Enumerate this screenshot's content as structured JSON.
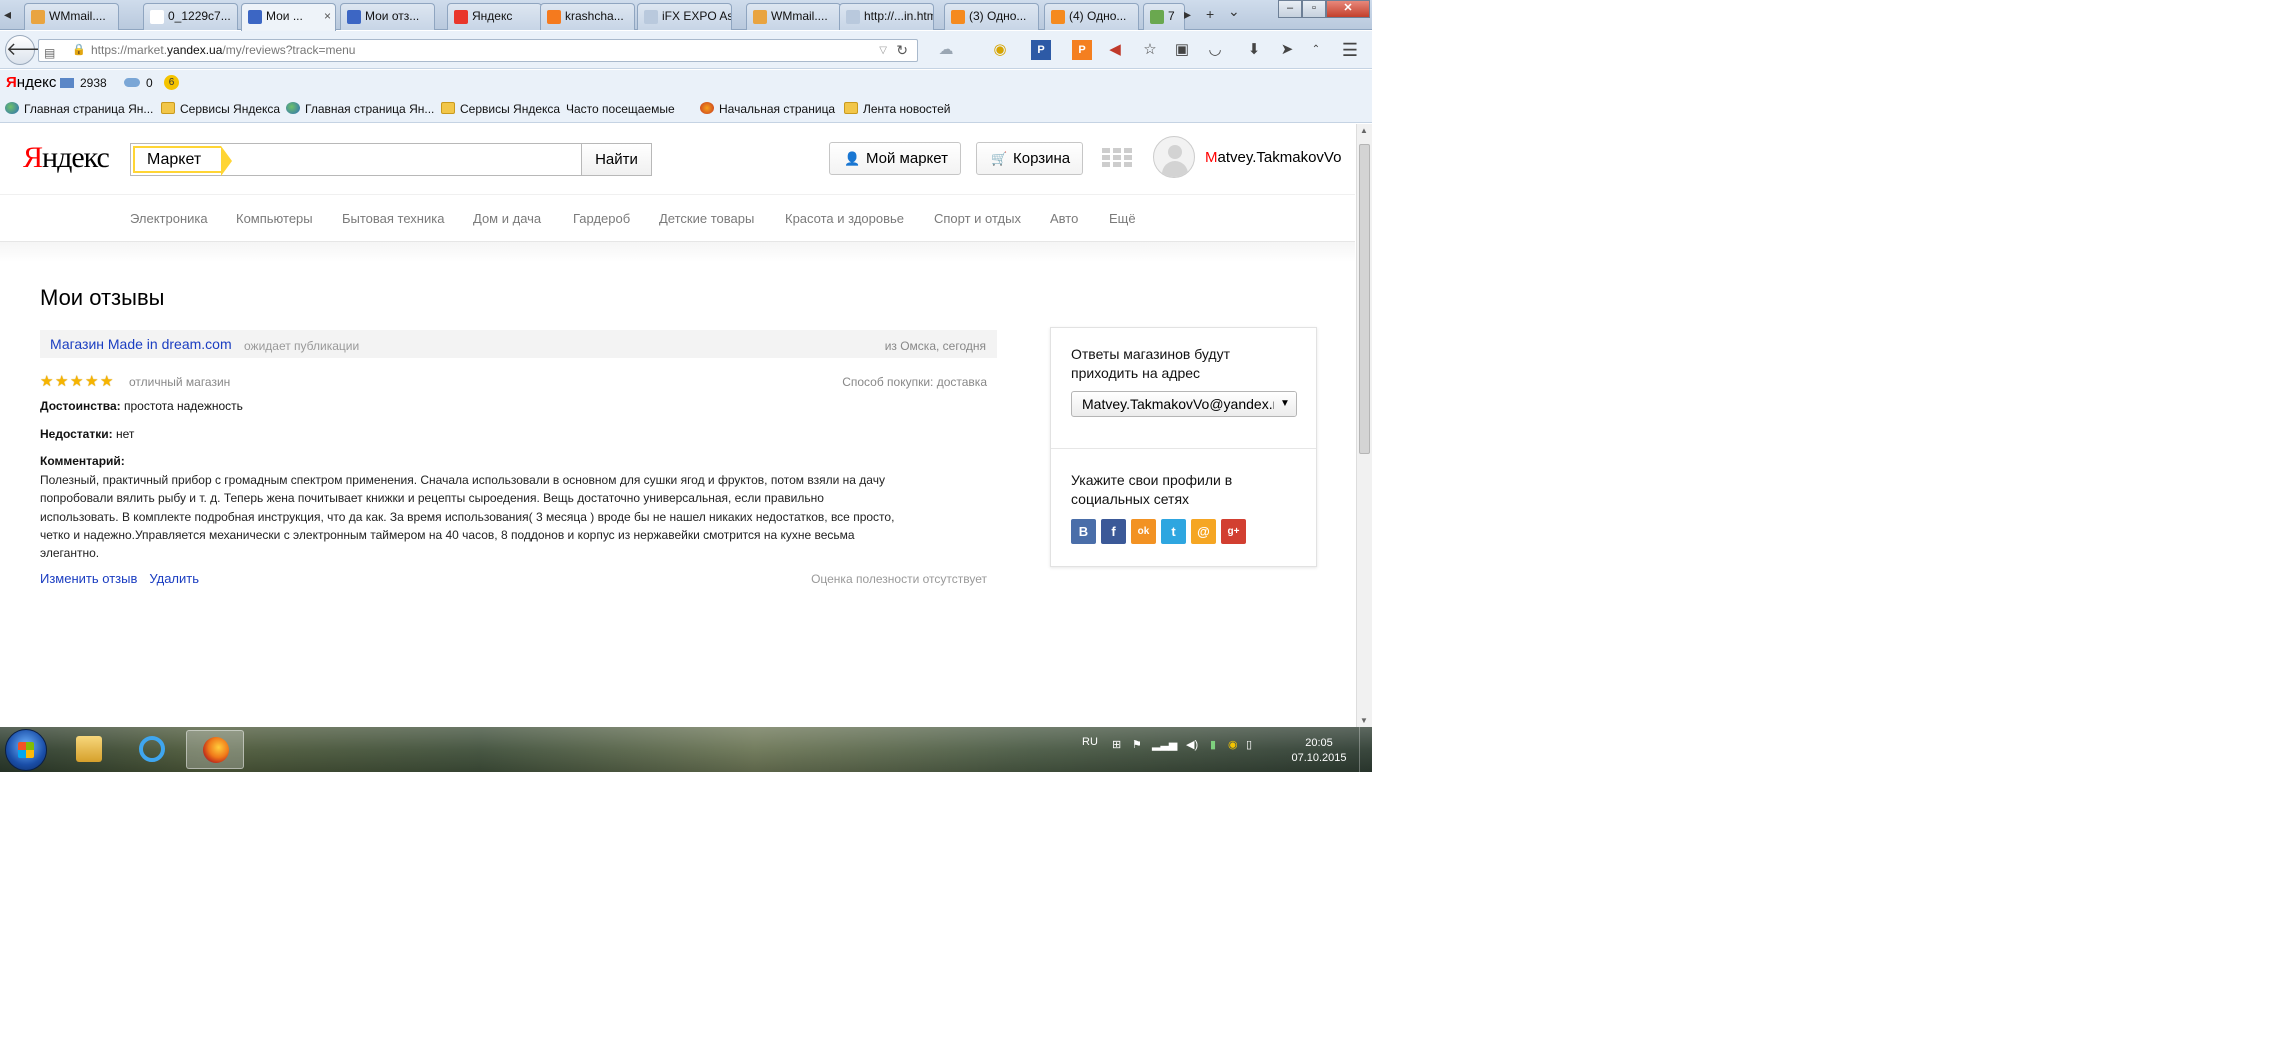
{
  "browser": {
    "tabs": [
      {
        "label": "WMmail....",
        "icon_color": "#e9a440"
      },
      {
        "label": "0_1229c7...",
        "icon_color": "#ffffff"
      },
      {
        "label": "Мои ...",
        "icon_color": "#3c66c4",
        "active": true
      },
      {
        "label": "Мои отз...",
        "icon_color": "#3c66c4"
      },
      {
        "label": "Яндекс",
        "icon_color": "#e9362b"
      },
      {
        "label": "krashcha...",
        "icon_color": "#f57a1e"
      },
      {
        "label": "iFX EXPO Asia...",
        "icon_color": "#b9c9dd"
      },
      {
        "label": "WMmail....",
        "icon_color": "#e9a440"
      },
      {
        "label": "http://...in.html",
        "icon_color": "#b9c9dd"
      },
      {
        "label": "(3) Одно...",
        "icon_color": "#f58a1e"
      },
      {
        "label": "(4) Одно...",
        "icon_color": "#f58a1e"
      },
      {
        "label": "7",
        "icon_color": "#6aa84f"
      }
    ],
    "tab_close": "×",
    "new_tab": "+",
    "tabs_menu": "⌄",
    "url": {
      "prefix": "https://market.",
      "host": "yandex.ua",
      "path": "/my/reviews?track=menu"
    },
    "back_glyph": "🡐"
  },
  "yandex_bar": {
    "logo_first": "Я",
    "logo_rest": "ндекс",
    "mail_count": "2938",
    "disk_count": "0",
    "bonus_badge": "6"
  },
  "bookmarks": [
    {
      "label": "Главная страница Ян...",
      "icon": "globe"
    },
    {
      "label": "Сервисы Яндекса",
      "icon": "folder"
    },
    {
      "label": "Главная страница Ян...",
      "icon": "globe"
    },
    {
      "label": "Сервисы Яндекса",
      "icon": "folder"
    },
    {
      "label": "Часто посещаемые",
      "icon": "none"
    },
    {
      "label": "Начальная страница",
      "icon": "firefox"
    },
    {
      "label": "Лента новостей",
      "icon": "folder"
    }
  ],
  "header": {
    "logo_first": "Я",
    "logo_rest": "ндекс",
    "search_tag": "Маркет",
    "search_button": "Найти",
    "my_market": "Мой маркет",
    "cart": "Корзина",
    "user_first": "M",
    "user_rest": "atvey.TakmakovVo"
  },
  "categories": [
    "Электроника",
    "Компьютеры",
    "Бытовая техника",
    "Дом и дача",
    "Гардероб",
    "Детские товары",
    "Красота и здоровье",
    "Спорт и отдых",
    "Авто",
    "Ещё"
  ],
  "page": {
    "title": "Мои отзывы"
  },
  "review": {
    "shop": "Магазин Made in dream.com",
    "status": "ожидает публикации",
    "from": "из Омска, сегодня",
    "rating": 5,
    "verdict": "отличный магазин",
    "purchase_method": "Способ покупки: доставка",
    "pros_label": "Достоинства:",
    "pros": "простота надежность",
    "cons_label": "Недостатки:",
    "cons": "нет",
    "comment_label": "Комментарий:",
    "comment_lines": [
      "Полезный, практичный прибор с громадным спектром применения. Сначала использовали в основном для сушки ягод и фруктов, потом взяли на дачу",
      "попробовали вялить рыбу и т. д. Теперь жена почитывает книжки и рецепты сыроедения. Вещь достаточно универсальная, если правильно",
      "использовать. В комплекте подробная инструкция, что да как. За время использования( 3 месяца ) вроде бы не нашел никаких недостатков, все просто,",
      "четко и надежно.Управляется механически с электронным таймером на 40 часов, 8 поддонов и корпус из нержавейки смотрится на кухне весьма",
      "элегантно."
    ],
    "edit_link": "Изменить отзыв",
    "delete_link": "Удалить",
    "usefulness": "Оценка полезности отсутствует"
  },
  "sidebar": {
    "replies_text": "Ответы магазинов будут приходить на адрес",
    "email_select": "Matvey.TakmakovVo@yandex.ru",
    "social_text": "Укажите свои профили в социальных сетях",
    "socials": [
      {
        "name": "vkontakte",
        "glyph": "В",
        "color": "#4a6ea9"
      },
      {
        "name": "facebook",
        "glyph": "f",
        "color": "#3b5998"
      },
      {
        "name": "odnoklassniki",
        "glyph": "ok",
        "color": "#f29223"
      },
      {
        "name": "twitter",
        "glyph": "t",
        "color": "#2ea6e0"
      },
      {
        "name": "mailru",
        "glyph": "@",
        "color": "#f5a623"
      },
      {
        "name": "googleplus",
        "glyph": "g+",
        "color": "#d23f31"
      }
    ]
  },
  "taskbar": {
    "lang": "RU",
    "time": "20:05",
    "date": "07.10.2015"
  }
}
